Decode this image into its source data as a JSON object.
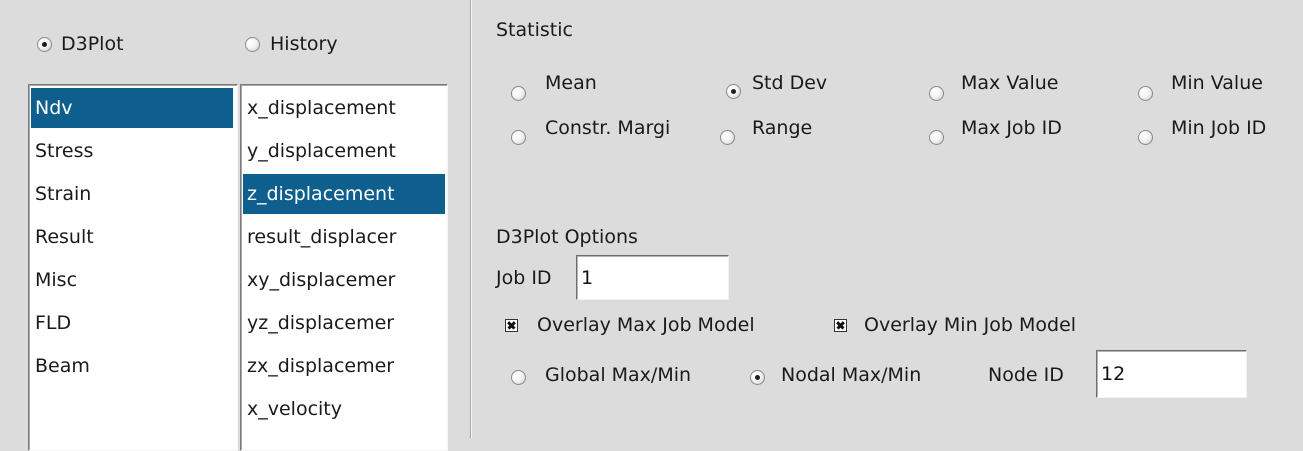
{
  "source": {
    "d3plot_label": "D3Plot",
    "history_label": "History",
    "selected": "D3Plot"
  },
  "categories": {
    "items": [
      "Ndv",
      "Stress",
      "Strain",
      "Result",
      "Misc",
      "FLD",
      "Beam"
    ],
    "selected": "Ndv"
  },
  "variables": {
    "items": [
      "x_displacement",
      "y_displacement",
      "z_displacement",
      "result_displacer",
      "xy_displacemer",
      "yz_displacemer",
      "zx_displacemer",
      "x_velocity"
    ],
    "selected": "z_displacement"
  },
  "statistic": {
    "title": "Statistic",
    "options": [
      "Mean",
      "Std Dev",
      "Max Value",
      "Min Value",
      "Constr. Margi",
      "Range",
      "Max Job ID",
      "Min Job ID"
    ],
    "selected": "Std Dev"
  },
  "d3plot_options": {
    "title": "D3Plot Options",
    "job_id_label": "Job ID",
    "job_id_value": "1",
    "overlay_max_label": "Overlay Max Job Model",
    "overlay_max_checked": true,
    "overlay_min_label": "Overlay Min Job Model",
    "overlay_min_checked": true,
    "global_label": "Global Max/Min",
    "nodal_label": "Nodal Max/Min",
    "maxmin_selected": "Nodal Max/Min",
    "node_id_label": "Node ID",
    "node_id_value": "12"
  },
  "colors": {
    "background": "#dcdcdc",
    "selection": "#0f5f8e",
    "list_background": "#ffffff"
  }
}
